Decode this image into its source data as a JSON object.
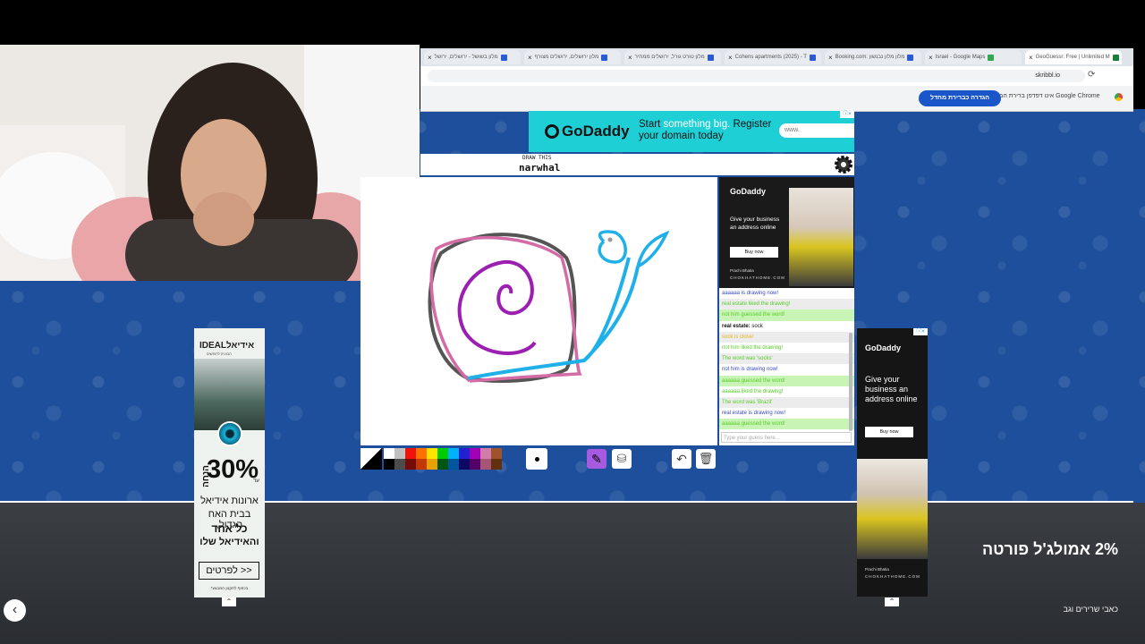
{
  "browser": {
    "tabs": [
      {
        "label": "מלון בשושל - ירושלים, ירושל"
      },
      {
        "label": "מלון ירושלים, ירושלים מצורף"
      },
      {
        "label": "מלון טורט גורל, ירושלים ממחיר"
      },
      {
        "label": "Cohens apartments (2025) - T"
      },
      {
        "label": "Booking.com: מלון מלון נבנשון"
      },
      {
        "label": "Israel - Google Maps"
      },
      {
        "label": "GeoGuessr: Free | Unlimited M"
      }
    ],
    "url": "skribbl.io",
    "info_text": "אינו דפדפן ברירת המחדל שלך Google Chrome",
    "info_button": "הגדרה כברירת מחדל"
  },
  "game": {
    "word_hint": "DRAW THIS",
    "word": "narwhal",
    "chat_placeholder": "Type your guess here...",
    "chat": [
      {
        "text": "aaaaaa is drawing now!",
        "color": "#3949c9",
        "bg": "#ffffff"
      },
      {
        "text": "real estate liked the drawing!",
        "color": "#56ce27",
        "bg": "#ececec"
      },
      {
        "text": "not him guessed the word!",
        "color": "#56ce27",
        "bg": "#c8f5b6"
      },
      {
        "text": "real estate: sock",
        "color": "#111111",
        "bg": "#ffffff",
        "bold_prefix": "real estate:",
        "rest": " sock"
      },
      {
        "text": "sock is close!",
        "color": "#e5b418",
        "bg": "#ececec"
      },
      {
        "text": "not him liked the drawing!",
        "color": "#56ce27",
        "bg": "#ffffff"
      },
      {
        "text": "The word was 'socks'",
        "color": "#56ce27",
        "bg": "#ececec"
      },
      {
        "text": "not him is drawing now!",
        "color": "#3949c9",
        "bg": "#ffffff"
      },
      {
        "text": "aaaaaa guessed the word!",
        "color": "#56ce27",
        "bg": "#c8f5b6"
      },
      {
        "text": "aaaaaa liked the drawing!",
        "color": "#56ce27",
        "bg": "#ffffff"
      },
      {
        "text": "The word was 'Brazil'",
        "color": "#56ce27",
        "bg": "#ececec"
      },
      {
        "text": "real estate is drawing now!",
        "color": "#3949c9",
        "bg": "#ffffff"
      },
      {
        "text": "aaaaaa guessed the word!",
        "color": "#56ce27",
        "bg": "#c8f5b6"
      }
    ],
    "palette": [
      "#ffffff",
      "#c1c1c1",
      "#ef130b",
      "#ff7100",
      "#ffe400",
      "#00cc00",
      "#00b2ff",
      "#231fd3",
      "#a300ba",
      "#d37caa",
      "#a0522d",
      "#000000",
      "#4c4c4c",
      "#740b07",
      "#c23800",
      "#e8a200",
      "#005510",
      "#00569e",
      "#0e0865",
      "#550069",
      "#a75574",
      "#63300d"
    ]
  },
  "ads": {
    "godaddy_brand": "GoDaddy",
    "top_ad_line1_a": "Start ",
    "top_ad_line1_b": "something big.",
    "top_ad_line1_c": " Register",
    "top_ad_line2": "your domain today",
    "top_ad_input": "www.",
    "side_ad_text": "Give your business an address online",
    "side_ad_button": "Buy now",
    "side_ad_credit": "Prachi Bhatia",
    "side_ad_site": "CHOKHATHOME.COM",
    "right_ad_text": "Give your business an address online",
    "right_ad_button": "Buy now",
    "ideal_brand": "IDEALאידיאל",
    "ideal_sub": "הבוטיק לחופשים",
    "ideal_discount": "30%",
    "ideal_upto": "עד",
    "ideal_off": "הנחה",
    "ideal_line1": "ארונות אידיאל",
    "ideal_line2": "בבית האח הגדול,",
    "ideal_line3": "כל אחד",
    "ideal_line4": "והאידיאל שלו",
    "ideal_cta": "לפרטים >>",
    "ideal_fine": "*בכפוף לתקנון המבצע"
  },
  "bottom": {
    "headline": "2% אמולג'ל פורטה",
    "sub": "כאבי שרירים וגב"
  }
}
